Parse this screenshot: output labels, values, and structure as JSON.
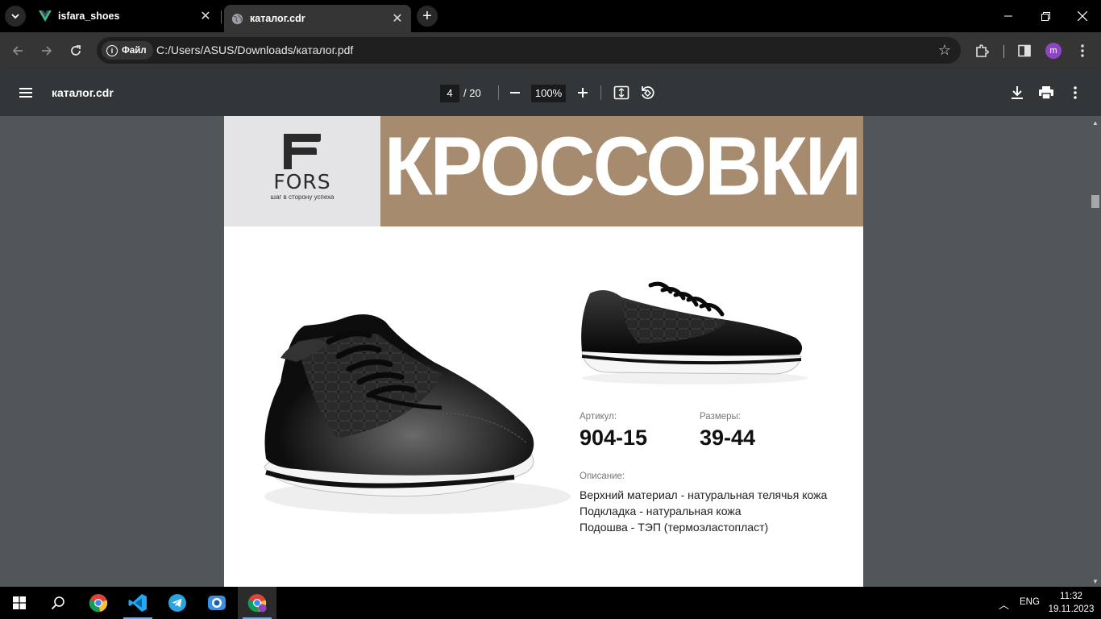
{
  "browser": {
    "tabs": [
      {
        "title": "isfara_shoes",
        "favicon": "vue-icon"
      },
      {
        "title": "каталог.cdr",
        "favicon": "globe-icon",
        "active": true
      }
    ],
    "address": {
      "chip_label": "Файл",
      "url": "C:/Users/ASUS/Downloads/каталог.pdf"
    },
    "profile_initial": "m"
  },
  "pdf_viewer": {
    "title": "каталог.cdr",
    "page_current": "4",
    "page_total": "/ 20",
    "zoom": "100%"
  },
  "catalog_page": {
    "brand": {
      "name": "FORS",
      "tagline": "шаг в сторону успеха"
    },
    "heading": "КРОССОВКИ",
    "article_label": "Артикул:",
    "article_value": "904-15",
    "sizes_label": "Размеры:",
    "sizes_value": "39-44",
    "description_label": "Описание:",
    "description_lines": [
      "Верхний материал - натуральная телячья кожа",
      "Подкладка - натуральная кожа",
      "Подошва - ТЭП (термоэластопласт)"
    ],
    "colors": {
      "banner": "#a78b6f",
      "logo_bg": "#e4e4e6"
    }
  },
  "taskbar": {
    "apps": [
      "windows-start",
      "search",
      "chrome",
      "vscode",
      "telegram",
      "camera-app",
      "chrome-profile"
    ],
    "language": "ENG",
    "time": "11:32",
    "date": "19.11.2023"
  }
}
